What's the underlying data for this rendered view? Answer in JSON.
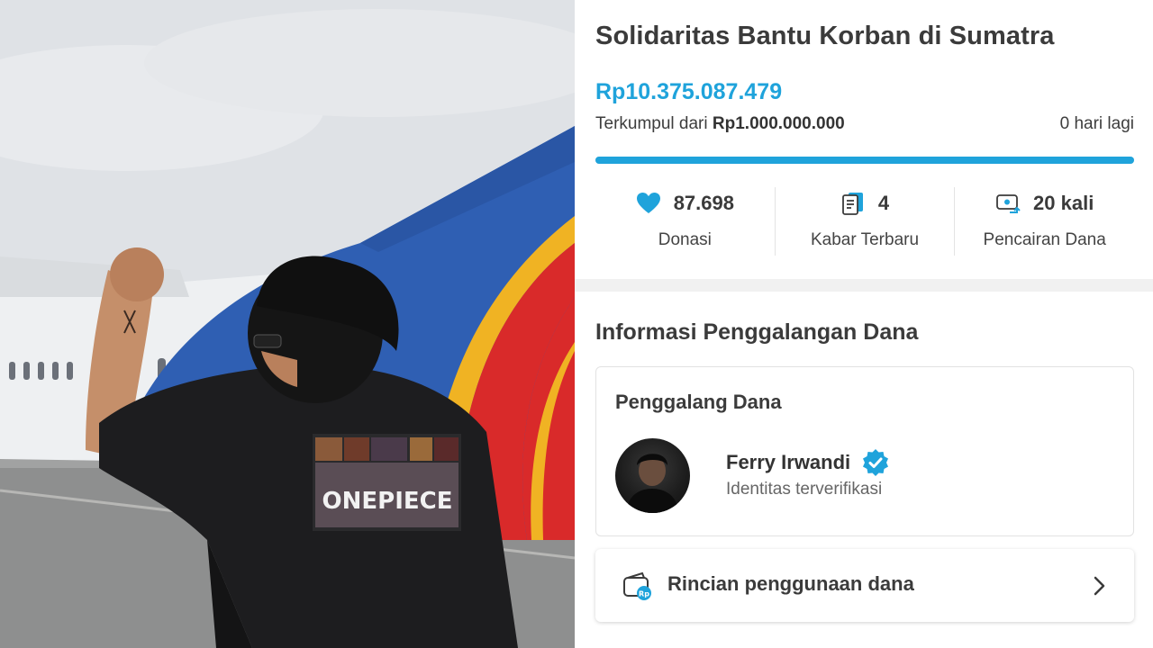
{
  "campaign": {
    "title": "Solidaritas Bantu Korban di Sumatra",
    "raised": "Rp10.375.087.479",
    "target_prefix": "Terkumpul dari ",
    "target_amount": "Rp1.000.000.000",
    "days_left": "0 hari lagi",
    "progress_fraction": 1.0
  },
  "stats": [
    {
      "value": "87.698",
      "label": "Donasi",
      "icon": "heart-icon"
    },
    {
      "value": "4",
      "label": "Kabar Terbaru",
      "icon": "news-icon"
    },
    {
      "value": "20 kali",
      "label": "Pencairan Dana",
      "icon": "disbursement-icon"
    }
  ],
  "info": {
    "section_title": "Informasi Penggalangan Dana",
    "card_title": "Penggalang Dana",
    "fundraiser_name": "Ferry Irwandi",
    "fundraiser_status": "Identitas terverifikasi",
    "detail_label": "Rincian penggunaan dana"
  },
  "photo": {
    "jacket_text": "ONEPIECE"
  },
  "colors": {
    "accent": "#1fa3db",
    "text": "#3b3b3b",
    "verified": "#1fa3db"
  }
}
